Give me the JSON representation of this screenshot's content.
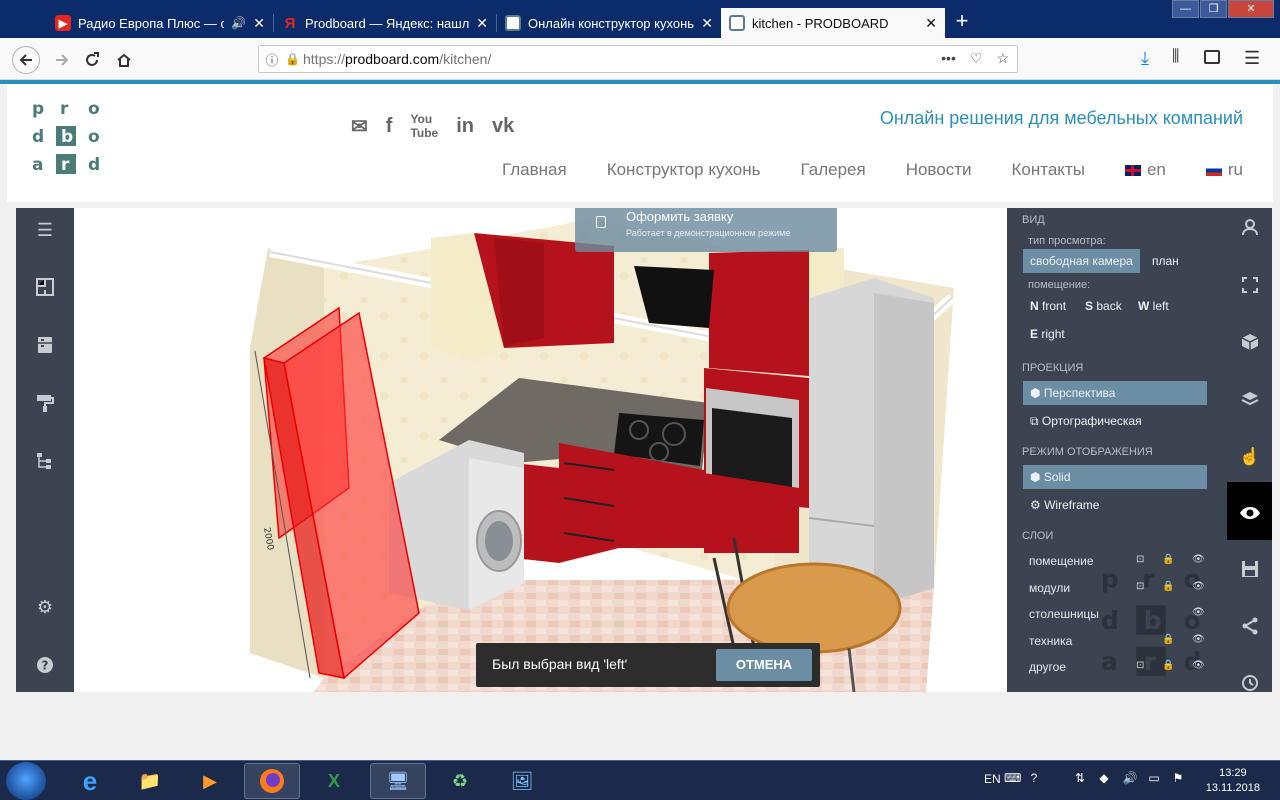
{
  "browser": {
    "tabs": [
      {
        "label": "Радио Европа Плюс — слу",
        "icon_color": "#e52620",
        "icon": "youtube-icon",
        "extra": "speaker-icon"
      },
      {
        "label": "Prodboard — Яндекс: нашлос",
        "icon_color": "#e52620",
        "icon": "yandex-icon"
      },
      {
        "label": "Онлайн конструктор кухонь |",
        "icon_color": "#5a7d8a",
        "icon": "prodboard-icon"
      },
      {
        "label": "kitchen - PRODBOARD",
        "icon_color": "#5a7d8a",
        "icon": "prodboard-icon"
      }
    ],
    "new_tab": "+",
    "url": {
      "proto": "https://",
      "host": "prodboard.com",
      "path": "/kitchen/"
    }
  },
  "site": {
    "tagline": "Онлайн решения для мебельных компаний",
    "menu": [
      "Главная",
      "Конструктор кухонь",
      "Галерея",
      "Новости",
      "Контакты"
    ],
    "lang_en": "en",
    "lang_ru": "ru",
    "logo_letters": [
      "p",
      "r",
      "o",
      "d",
      "b",
      "o",
      "a",
      "r",
      "d"
    ]
  },
  "app": {
    "order_button": {
      "title": "Оформить заявку",
      "subtitle": "Работает в демонстрационном режиме"
    },
    "dimension_label": "2000",
    "toast": {
      "message": "Был выбран вид 'left'",
      "undo": "ОТМЕНА"
    },
    "panel": {
      "view_title": "вид",
      "view_type_label": "тип просмотра:",
      "view_free": "свободная камера",
      "view_plan": "план",
      "room_label": "помещение:",
      "n_key": "N",
      "n_label": "front",
      "s_key": "S",
      "s_label": "back",
      "w_key": "W",
      "w_label": "left",
      "e_key": "E",
      "e_label": "right",
      "projection_title": "проекция",
      "perspective": "Перспектива",
      "orthographic": "Ортографическая",
      "render_title": "режим отображения",
      "solid": "Solid",
      "wireframe": "Wireframe",
      "layers_title": "слои",
      "layers": [
        {
          "name": "помещение"
        },
        {
          "name": "модули"
        },
        {
          "name": "столешницы"
        },
        {
          "name": "техника"
        },
        {
          "name": "другое"
        }
      ]
    }
  },
  "taskbar": {
    "lang": "EN",
    "time": "13:29",
    "date": "13.11.2018"
  },
  "colors": {
    "accent": "#2a8fbd",
    "panel_bg": "#3b4450",
    "active_btn": "#6b8ea5",
    "cabinet_red": "#b5121b"
  }
}
